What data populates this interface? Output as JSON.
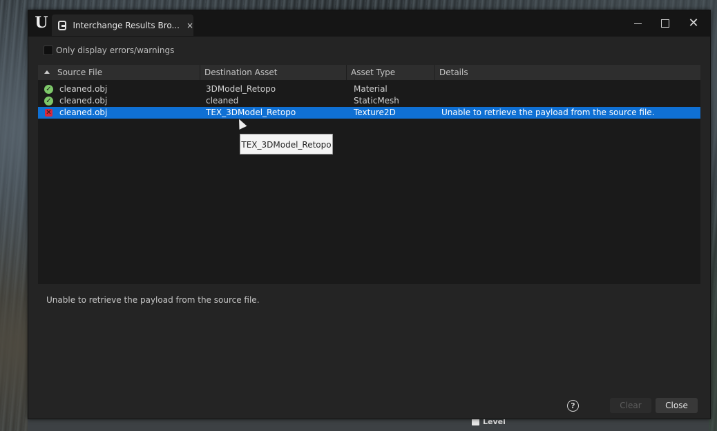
{
  "window": {
    "tab_title": "Interchange Results Bro...",
    "tab_close": "×",
    "minimize_icon": "minimize-icon",
    "maximize_icon": "maximize-icon",
    "close_glyph": "✕"
  },
  "filter": {
    "label": "Only display errors/warnings",
    "checked": false
  },
  "columns": [
    "Source File",
    "Destination Asset",
    "Asset Type",
    "Details"
  ],
  "rows": [
    {
      "status": "success",
      "source": "cleaned.obj",
      "destination": "3DModel_Retopo",
      "type": "Material",
      "details": ""
    },
    {
      "status": "success",
      "source": "cleaned.obj",
      "destination": "cleaned",
      "type": "StaticMesh",
      "details": ""
    },
    {
      "status": "error",
      "source": "cleaned.obj",
      "destination": "TEX_3DModel_Retopo",
      "type": "Texture2D",
      "details": "Unable to retrieve the payload from the source file."
    }
  ],
  "tooltip": "TEX_3DModel_Retopo",
  "details_panel": "Unable to retrieve the payload from the source file.",
  "footer": {
    "help": "?",
    "clear_label": "Clear",
    "close_label": "Close"
  },
  "background_level_label": "Level",
  "colors": {
    "selection": "#0f70d4",
    "success": "#7ec86a",
    "error": "#d9283a"
  }
}
